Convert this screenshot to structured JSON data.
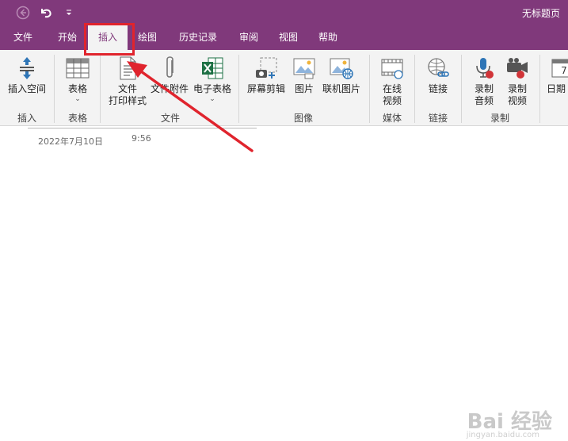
{
  "window": {
    "title": "无标题页"
  },
  "menu": {
    "tabs": [
      {
        "label": "文件"
      },
      {
        "label": "开始"
      },
      {
        "label": "插入",
        "active": true
      },
      {
        "label": "绘图"
      },
      {
        "label": "历史记录"
      },
      {
        "label": "审阅"
      },
      {
        "label": "视图"
      },
      {
        "label": "帮助"
      }
    ]
  },
  "ribbon": {
    "insert_space": "插入空间",
    "group_insert": "插入",
    "table": "表格",
    "group_table": "表格",
    "file_printout_line1": "文件",
    "file_printout_line2": "打印样式",
    "file_attachment": "文件附件",
    "spreadsheet": "电子表格",
    "group_file": "文件",
    "screen_clipping": "屏幕剪辑",
    "pictures": "图片",
    "online_pictures": "联机图片",
    "group_images": "图像",
    "online_video_line1": "在线",
    "online_video_line2": "视频",
    "group_media": "媒体",
    "link": "链接",
    "group_links": "链接",
    "record_audio_line1": "录制",
    "record_audio_line2": "音频",
    "record_video_line1": "录制",
    "record_video_line2": "视频",
    "group_recording": "录制",
    "date_partial": "日期"
  },
  "page": {
    "date": "2022年7月10日",
    "time": "9:56"
  },
  "watermark": {
    "text": "Bai 经验",
    "url": "jingyan.baidu.com"
  },
  "colors": {
    "accent": "#80397b",
    "highlight": "#e0242d",
    "ribbon_bg": "#f3f3f3"
  }
}
